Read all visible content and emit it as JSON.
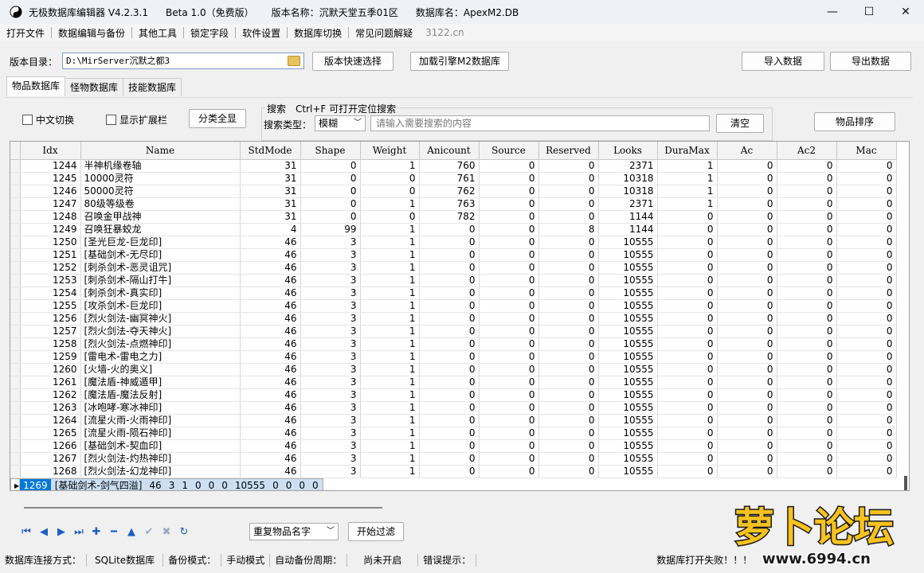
{
  "titlebar": {
    "app": "无极数据库编辑器 V4.2.3.1",
    "edition": "Beta 1.0（免费版）",
    "version_name": "版本名称：沉默天堂五季01区",
    "db_name": "数据库名：ApexM2.DB",
    "minimize": "—",
    "maximize": "☐",
    "close": "✕"
  },
  "menu": [
    "打开文件",
    "数据编辑与备份",
    "其他工具",
    "锁定字段",
    "软件设置",
    "数据库切换",
    "常见问题解疑"
  ],
  "menu_site": "3122.cn",
  "toolbar": {
    "dir_label": "版本目录：",
    "dir_value": "D:\\MirServer沉默之都3",
    "quick_select": "版本快速选择",
    "load_engine": "加载引擎M2数据库",
    "import": "导入数据",
    "export": "导出数据"
  },
  "tabs": [
    "物品数据库",
    "怪物数据库",
    "技能数据库"
  ],
  "filters": {
    "chinese_toggle": "中文切换",
    "show_ext": "显示扩展栏",
    "all_categories": "分类全显",
    "search_legend": "搜索　Ctrl+F 可打开定位搜索",
    "search_type_label": "搜索类型：",
    "search_type_value": "模糊",
    "search_placeholder": "请输入需要搜索的内容",
    "clear": "清空",
    "sort": "物品排序"
  },
  "table": {
    "columns": [
      "Idx",
      "Name",
      "StdMode",
      "Shape",
      "Weight",
      "Anicount",
      "Source",
      "Reserved",
      "Looks",
      "DuraMax",
      "Ac",
      "Ac2",
      "Mac"
    ],
    "rows": [
      [
        "1244",
        "半神机缘卷轴",
        "31",
        "0",
        "1",
        "760",
        "0",
        "0",
        "2371",
        "1",
        "0",
        "0",
        "0"
      ],
      [
        "1245",
        "10000灵符",
        "31",
        "0",
        "0",
        "761",
        "0",
        "0",
        "10318",
        "1",
        "0",
        "0",
        "0"
      ],
      [
        "1246",
        "50000灵符",
        "31",
        "0",
        "0",
        "762",
        "0",
        "0",
        "10318",
        "1",
        "0",
        "0",
        "0"
      ],
      [
        "1247",
        "80级等级卷",
        "31",
        "0",
        "1",
        "763",
        "0",
        "0",
        "2371",
        "1",
        "0",
        "0",
        "0"
      ],
      [
        "1248",
        "召唤金甲战神",
        "31",
        "0",
        "0",
        "782",
        "0",
        "0",
        "1144",
        "0",
        "0",
        "0",
        "0"
      ],
      [
        "1249",
        "召唤狂暴蛟龙",
        "4",
        "99",
        "1",
        "0",
        "0",
        "8",
        "1144",
        "0",
        "0",
        "0",
        "0"
      ],
      [
        "1250",
        "[圣光巨龙-巨龙印]",
        "46",
        "3",
        "1",
        "0",
        "0",
        "0",
        "10555",
        "0",
        "0",
        "0",
        "0"
      ],
      [
        "1251",
        "[基础剑术-无尽印]",
        "46",
        "3",
        "1",
        "0",
        "0",
        "0",
        "10555",
        "0",
        "0",
        "0",
        "0"
      ],
      [
        "1252",
        "[刺杀剑术-恶灵诅咒]",
        "46",
        "3",
        "1",
        "0",
        "0",
        "0",
        "10555",
        "0",
        "0",
        "0",
        "0"
      ],
      [
        "1253",
        "[刺杀剑术-隔山打牛]",
        "46",
        "3",
        "1",
        "0",
        "0",
        "0",
        "10555",
        "0",
        "0",
        "0",
        "0"
      ],
      [
        "1254",
        "[刺杀剑术-真实印]",
        "46",
        "3",
        "1",
        "0",
        "0",
        "0",
        "10555",
        "0",
        "0",
        "0",
        "0"
      ],
      [
        "1255",
        "[攻杀剑术-巨龙印]",
        "46",
        "3",
        "1",
        "0",
        "0",
        "0",
        "10555",
        "0",
        "0",
        "0",
        "0"
      ],
      [
        "1256",
        "[烈火剑法-幽冥神火]",
        "46",
        "3",
        "1",
        "0",
        "0",
        "0",
        "10555",
        "0",
        "0",
        "0",
        "0"
      ],
      [
        "1257",
        "[烈火剑法-夺天神火]",
        "46",
        "3",
        "1",
        "0",
        "0",
        "0",
        "10555",
        "0",
        "0",
        "0",
        "0"
      ],
      [
        "1258",
        "[烈火剑法-点燃神印]",
        "46",
        "3",
        "1",
        "0",
        "0",
        "0",
        "10555",
        "0",
        "0",
        "0",
        "0"
      ],
      [
        "1259",
        "[雷电术-雷电之力]",
        "46",
        "3",
        "1",
        "0",
        "0",
        "0",
        "10555",
        "0",
        "0",
        "0",
        "0"
      ],
      [
        "1260",
        "[火墙-火的奥义]",
        "46",
        "3",
        "1",
        "0",
        "0",
        "0",
        "10555",
        "0",
        "0",
        "0",
        "0"
      ],
      [
        "1261",
        "[魔法盾-神威遁甲]",
        "46",
        "3",
        "1",
        "0",
        "0",
        "0",
        "10555",
        "0",
        "0",
        "0",
        "0"
      ],
      [
        "1262",
        "[魔法盾-魔法反射]",
        "46",
        "3",
        "1",
        "0",
        "0",
        "0",
        "10555",
        "0",
        "0",
        "0",
        "0"
      ],
      [
        "1263",
        "[冰咆哮-寒冰神印]",
        "46",
        "3",
        "1",
        "0",
        "0",
        "0",
        "10555",
        "0",
        "0",
        "0",
        "0"
      ],
      [
        "1264",
        "[流星火雨-火雨神印]",
        "46",
        "3",
        "1",
        "0",
        "0",
        "0",
        "10555",
        "0",
        "0",
        "0",
        "0"
      ],
      [
        "1265",
        "[流星火雨-陨石神印]",
        "46",
        "3",
        "1",
        "0",
        "0",
        "0",
        "10555",
        "0",
        "0",
        "0",
        "0"
      ],
      [
        "1266",
        "[基础剑术-契血印]",
        "46",
        "3",
        "1",
        "0",
        "0",
        "0",
        "10555",
        "0",
        "0",
        "0",
        "0"
      ],
      [
        "1267",
        "[烈火剑法-灼热神印]",
        "46",
        "3",
        "1",
        "0",
        "0",
        "0",
        "10555",
        "0",
        "0",
        "0",
        "0"
      ],
      [
        "1268",
        "[烈火剑法-幻龙神印]",
        "46",
        "3",
        "1",
        "0",
        "0",
        "0",
        "10555",
        "0",
        "0",
        "0",
        "0"
      ],
      [
        "1269",
        "[基础剑术-剑气四溢]",
        "46",
        "3",
        "1",
        "0",
        "0",
        "0",
        "10555",
        "0",
        "0",
        "0",
        "0"
      ]
    ],
    "selected_index": 25
  },
  "bottom": {
    "nav_icons": [
      "first-icon",
      "prev-icon",
      "next-icon",
      "last-icon",
      "add-icon",
      "remove-icon",
      "up-icon",
      "check-icon",
      "cancel-icon",
      "refresh-icon"
    ],
    "nav_glyphs": [
      "⏮",
      "◀",
      "▶",
      "⏭",
      "✚",
      "━",
      "▲",
      "✔",
      "✖",
      "↻"
    ],
    "dup_filter_value": "重复物品名字",
    "start_filter": "开始过滤"
  },
  "status": {
    "conn_label": "数据库连接方式：",
    "conn_value": "SQLite数据库",
    "backup_label": "备份模式：",
    "backup_value": "手动模式",
    "auto_label": "自动备份周期：",
    "auto_value": "尚未开启",
    "error_label": "错误提示：",
    "error_value": "数据库打开失败！！！"
  },
  "watermark": {
    "logo_text": "萝卜论坛",
    "url": "www.6994.cn"
  }
}
